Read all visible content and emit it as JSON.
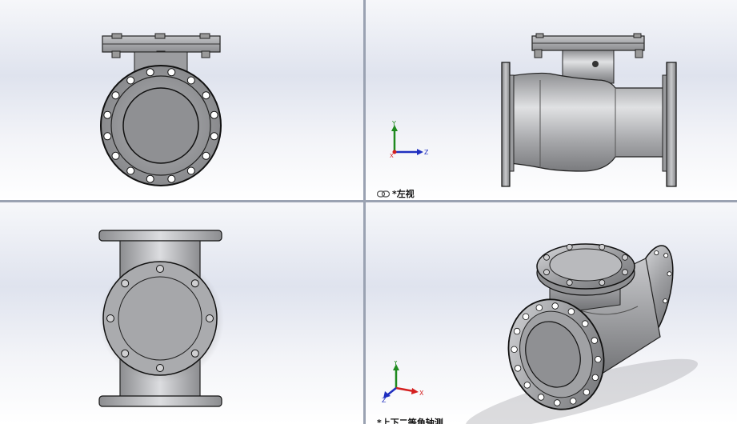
{
  "viewports": {
    "front": {},
    "left": {
      "label": "*左视"
    },
    "top": {},
    "isometric": {
      "label": "*上下二等角轴测"
    }
  },
  "triad_axes": {
    "x": "X",
    "y": "Y",
    "z": "Z"
  },
  "colors": {
    "axis_x": "#d42020",
    "axis_y": "#1f8a1f",
    "axis_z": "#2030c0",
    "model_metal": "#a4a5a8",
    "split_line": "#9aa2b2"
  },
  "icons": {
    "view_link": "link-icon"
  }
}
